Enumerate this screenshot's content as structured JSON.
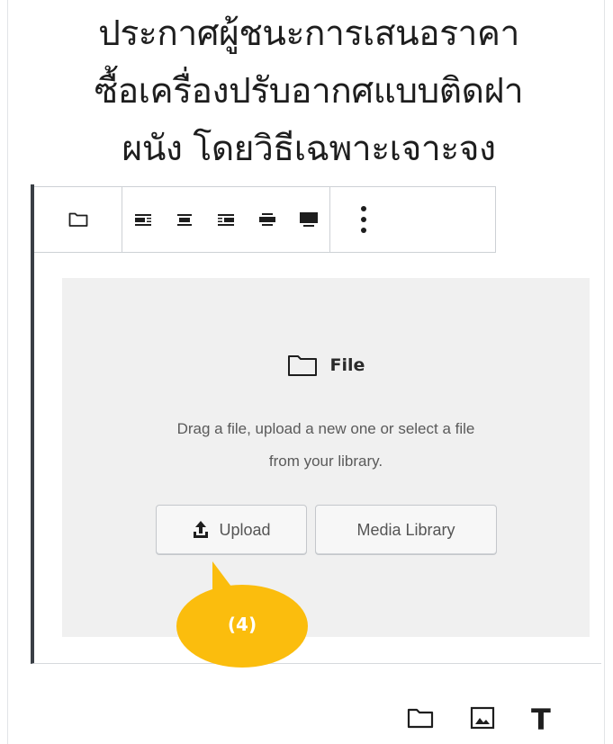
{
  "heading": {
    "lines": [
      "ประกาศผู้ชนะการเสนอราคา",
      "ซื้อเครื่องปรับอากศแบบติดฝา",
      "ผนัง โดยวิธีเฉพาะเจาะจง"
    ]
  },
  "toolbar": {
    "icons": [
      "folder-icon",
      "align-left-icon",
      "align-center-icon",
      "align-right-icon",
      "align-wide-icon",
      "align-full-icon",
      "more-vertical-icon"
    ]
  },
  "file_block": {
    "label": "File",
    "instructions_line1": "Drag a file, upload a new one or select a file",
    "instructions_line2": "from your library.",
    "upload_label": "Upload",
    "media_library_label": "Media Library"
  },
  "callout": {
    "number": "(4)",
    "color": "#fbbd0d"
  },
  "inserter": {
    "icons": [
      "folder-icon",
      "image-icon",
      "text-icon"
    ],
    "text_icon_glyph": "T"
  }
}
